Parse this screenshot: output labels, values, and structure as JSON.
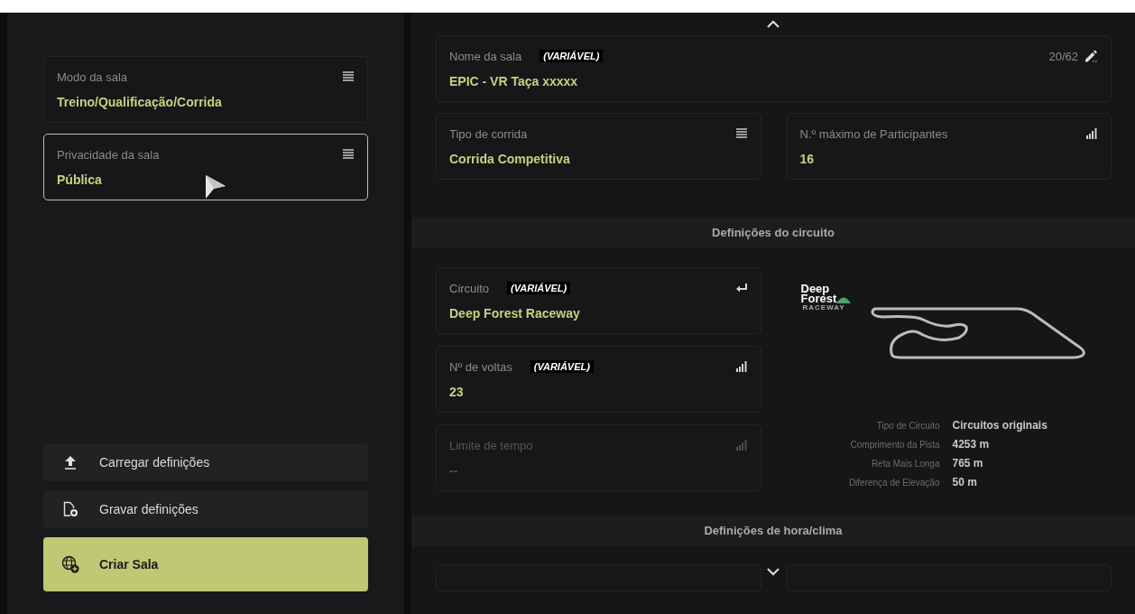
{
  "left": {
    "fields": [
      {
        "label": "Modo da sala",
        "value": "Treino/Qualificação/Corrida",
        "kind": "list",
        "selected": false
      },
      {
        "label": "Privacidade da sala",
        "value": "Pública",
        "kind": "list",
        "selected": true
      }
    ],
    "buttons": [
      {
        "label": "Carregar definições",
        "kind": "load"
      },
      {
        "label": "Gravar definições",
        "kind": "save"
      },
      {
        "label": "Criar Sala",
        "kind": "create"
      }
    ]
  },
  "right": {
    "name_field": {
      "label": "Nome da sala",
      "tag": "(VARIÁVEL)",
      "value": "EPIC - VR Taça xxxxx",
      "counter": "20/62"
    },
    "fields": [
      {
        "label": "Tipo de corrida",
        "value": "Corrida Competitiva",
        "kind": "list",
        "disabled": false
      },
      {
        "label": "N.º máximo de Participantes",
        "value": "16",
        "kind": "number",
        "disabled": false
      }
    ],
    "circuit_section": {
      "title": "Definições do circuito",
      "fields": [
        {
          "label": "Circuito",
          "tag": "(VARIÁVEL)",
          "value": "Deep Forest Raceway",
          "kind": "select",
          "disabled": false
        },
        {
          "label": "Nº de voltas",
          "tag": "(VARIÁVEL)",
          "value": "23",
          "kind": "number",
          "disabled": false
        },
        {
          "label": "Limite de tempo",
          "value": "--",
          "kind": "number",
          "disabled": true
        }
      ],
      "logo": {
        "line_1": "Deep",
        "line_2": "Forest",
        "line_3": "RACEWAY"
      },
      "info": [
        {
          "label": "Tipo de Circuito",
          "value": "Circuitos originais"
        },
        {
          "label": "Comprimento da Pista",
          "value": "4253 m"
        },
        {
          "label": "Reta Mais Longa",
          "value": "765 m"
        },
        {
          "label": "Diferença de Elevação",
          "value": "50 m"
        }
      ]
    },
    "time_section": {
      "title": "Definições de hora/clima"
    }
  }
}
